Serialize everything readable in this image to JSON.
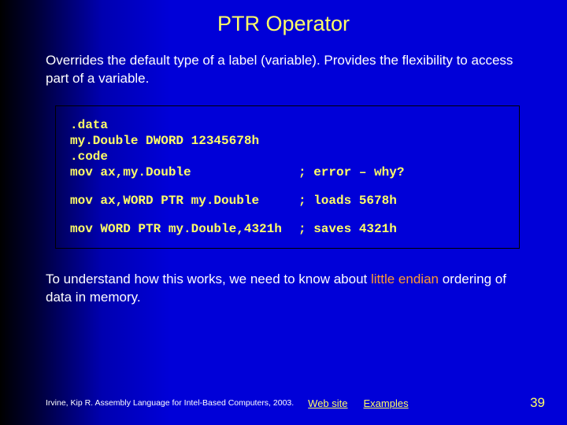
{
  "title": "PTR Operator",
  "description": "Overrides the default type of a label (variable). Provides the flexibility to access part of a variable.",
  "code": {
    "l1": ".data",
    "l2": "my.Double DWORD 12345678h",
    "l3": ".code",
    "l4_left": "mov ax,my.Double",
    "l4_right": "; error – why?",
    "l5_left": "mov ax,WORD PTR my.Double",
    "l5_right": "; loads 5678h",
    "l6_left": "mov WORD PTR my.Double,4321h",
    "l6_right": "; saves 4321h"
  },
  "explain_pre": "To understand how this works, we need to know about ",
  "explain_kw": "little endian",
  "explain_post": " ordering of data in memory.",
  "footer": {
    "credit": "Irvine, Kip R. Assembly Language for Intel-Based Computers, 2003.",
    "link1": "Web site",
    "link2": "Examples",
    "page": "39"
  }
}
